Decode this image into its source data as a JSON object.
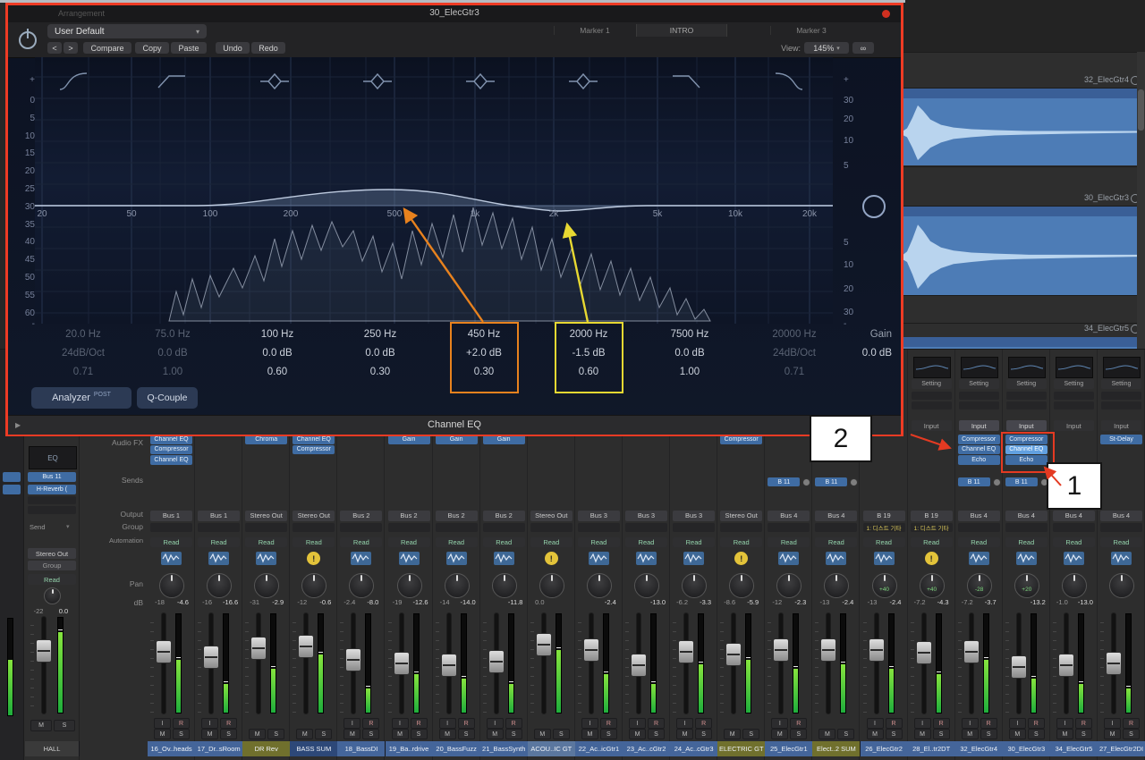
{
  "chrome": {
    "arrangement_label": "Arrangement"
  },
  "colors": {
    "annotation_red": "#ee3b24",
    "annotation_orange": "#e8821e",
    "annotation_yellow": "#e7d832",
    "plugin_open_blue": "#62a0e0",
    "region_blue": "#4d7cb6"
  },
  "eq_window": {
    "window_title": "30_ElecGtr3",
    "markers": [
      "Marker 1",
      "INTRO",
      "Marker 3"
    ],
    "preset_value": "User Default",
    "nav_prev": "<",
    "nav_next": ">",
    "buttons": {
      "compare": "Compare",
      "copy": "Copy",
      "paste": "Paste",
      "undo": "Undo",
      "redo": "Redo"
    },
    "view_label": "View:",
    "view_value": "145%",
    "link_icon": "∞",
    "scale_plus": "+",
    "scale_minus": "-",
    "freq_axis": [
      "20",
      "50",
      "100",
      "200",
      "500",
      "1k",
      "2k",
      "5k",
      "10k",
      "20k"
    ],
    "db_scale_left": [
      "0",
      "5",
      "10",
      "15",
      "20",
      "25",
      "30",
      "35",
      "40",
      "45",
      "50",
      "55",
      "60"
    ],
    "db_scale_right_top": [
      "30",
      "20",
      "10",
      "5"
    ],
    "db_scale_right_bottom": [
      "5",
      "10",
      "20",
      "30"
    ],
    "bands": [
      {
        "freq": "20.0 Hz",
        "gain": "24dB/Oct",
        "q": "0.71",
        "dim": true
      },
      {
        "freq": "75.0 Hz",
        "gain": "0.0 dB",
        "q": "1.00",
        "dim": true
      },
      {
        "freq": "100 Hz",
        "gain": "0.0 dB",
        "q": "0.60",
        "dim": false
      },
      {
        "freq": "250 Hz",
        "gain": "0.0 dB",
        "q": "0.30",
        "dim": false
      },
      {
        "freq": "450 Hz",
        "gain": "+2.0 dB",
        "q": "0.30",
        "dim": false
      },
      {
        "freq": "2000 Hz",
        "gain": "-1.5 dB",
        "q": "0.60",
        "dim": false
      },
      {
        "freq": "7500 Hz",
        "gain": "0.0 dB",
        "q": "1.00",
        "dim": false
      },
      {
        "freq": "20000 Hz",
        "gain": "24dB/Oct",
        "q": "0.71",
        "dim": true
      }
    ],
    "gain_label": "Gain",
    "gain_value": "0.0 dB",
    "analyzer_label": "Analyzer",
    "analyzer_mode": "POST",
    "q_couple_label": "Q-Couple",
    "footer_title": "Channel EQ"
  },
  "annotations": {
    "callout_1": "1",
    "callout_2": "2"
  },
  "arrange": {
    "tracks": [
      {
        "name": "32_ElecGtr4"
      },
      {
        "name": "30_ElecGtr3"
      },
      {
        "name": "34_ElecGtr5"
      }
    ]
  },
  "mixer": {
    "row_labels": [
      "Audio FX",
      "Sends",
      "Output",
      "Group",
      "Automation",
      "Pan",
      "dB"
    ],
    "common": {
      "setting": "Setting",
      "input": "Input",
      "read": "Read",
      "mute": "M",
      "solo": "S",
      "im": "I",
      "rec": "R"
    },
    "left_strip": {
      "eq_label": "EQ",
      "input": "Bus 11",
      "fx": "H-Reverb (",
      "send_label": "Send",
      "output": "Stereo Out",
      "group": "Group",
      "automation": "Read",
      "db_left": "-22",
      "db_right": "0.0",
      "mute": "M",
      "solo": "S",
      "name": "HALL"
    },
    "strips": [
      {
        "name": "16_Ov..heads",
        "fx": [
          "Channel EQ",
          "Compressor",
          "Channel EQ"
        ],
        "sends": [],
        "output": "Bus 1",
        "group": "",
        "pan": "",
        "db": [
          "-18",
          "-4.6"
        ],
        "icon": "wave",
        "ir": true,
        "top": false,
        "fader": 0.35,
        "meter": 0.55,
        "color": "blue"
      },
      {
        "name": "17_Dr..sRoom",
        "fx": [],
        "sends": [],
        "output": "Bus 1",
        "group": "",
        "pan": "",
        "db": [
          "-16",
          "-16.6"
        ],
        "icon": "wave",
        "ir": true,
        "top": false,
        "fader": 0.42,
        "meter": 0.3,
        "color": "blue"
      },
      {
        "name": "DR Rev",
        "fx": [
          "Chroma"
        ],
        "sends": [],
        "output": "Stereo Out",
        "group": "",
        "pan": "",
        "db": [
          "-31",
          "-2.9"
        ],
        "icon": "wave",
        "ir": false,
        "top": false,
        "fader": 0.3,
        "meter": 0.45,
        "color": "olive"
      },
      {
        "name": "BASS SUM",
        "fx": [
          "Channel EQ",
          "Compressor"
        ],
        "sends": [],
        "output": "Stereo Out",
        "group": "",
        "pan": "",
        "db": [
          "-12",
          "-0.6"
        ],
        "icon": "alert",
        "ir": false,
        "top": false,
        "fader": 0.28,
        "meter": 0.6,
        "color": "navy"
      },
      {
        "name": "18_BassDI",
        "fx": [],
        "sends": [],
        "output": "Bus 2",
        "group": "",
        "pan": "",
        "db": [
          "-2.4",
          "-8.0"
        ],
        "icon": "wave",
        "ir": true,
        "top": false,
        "fader": 0.45,
        "meter": 0.25,
        "color": "blue"
      },
      {
        "name": "19_Ba..rdrive",
        "fx": [
          "Gain"
        ],
        "sends": [],
        "output": "Bus 2",
        "group": "",
        "pan": "",
        "db": [
          "-19",
          "-12.6"
        ],
        "icon": "wave",
        "ir": true,
        "top": false,
        "fader": 0.5,
        "meter": 0.4,
        "color": "blue"
      },
      {
        "name": "20_BassFuzz",
        "fx": [
          "Gain"
        ],
        "sends": [],
        "output": "Bus 2",
        "group": "",
        "pan": "",
        "db": [
          "-14",
          "-14.0"
        ],
        "icon": "wave",
        "ir": true,
        "top": false,
        "fader": 0.52,
        "meter": 0.35,
        "color": "blue"
      },
      {
        "name": "21_BassSynth",
        "fx": [
          "Gain"
        ],
        "sends": [],
        "output": "Bus 2",
        "group": "",
        "pan": "",
        "db": [
          "",
          "-11.8"
        ],
        "icon": "wave",
        "ir": true,
        "top": false,
        "fader": 0.48,
        "meter": 0.3,
        "color": "blue"
      },
      {
        "name": "ACOU..IC GT",
        "fx": [],
        "sends": [],
        "output": "Stereo Out",
        "group": "",
        "pan": "",
        "db": [
          "0.0",
          ""
        ],
        "icon": "alert",
        "ir": false,
        "top": false,
        "fader": 0.25,
        "meter": 0.65,
        "color": "steel"
      },
      {
        "name": "22_Ac..icGtr1",
        "fx": [],
        "sends": [],
        "output": "Bus 3",
        "group": "",
        "pan": "",
        "db": [
          "",
          "-2.4"
        ],
        "icon": "wave",
        "ir": true,
        "top": false,
        "fader": 0.33,
        "meter": 0.4,
        "color": "blue"
      },
      {
        "name": "23_Ac..cGtr2",
        "fx": [],
        "sends": [],
        "output": "Bus 3",
        "group": "",
        "pan": "",
        "db": [
          "",
          "-13.0"
        ],
        "icon": "wave",
        "ir": true,
        "top": false,
        "fader": 0.52,
        "meter": 0.3,
        "color": "blue"
      },
      {
        "name": "24_Ac..cGtr3",
        "fx": [],
        "sends": [],
        "output": "Bus 3",
        "group": "",
        "pan": "",
        "db": [
          "-6.2",
          "-3.3"
        ],
        "icon": "wave",
        "ir": true,
        "top": false,
        "fader": 0.35,
        "meter": 0.5,
        "color": "blue"
      },
      {
        "name": "ELECTRIC GT",
        "fx": [
          "Compressor"
        ],
        "sends": [],
        "output": "Stereo Out",
        "group": "",
        "pan": "",
        "db": [
          "-8.6",
          "-5.9"
        ],
        "icon": "alert",
        "ir": false,
        "top": false,
        "fader": 0.38,
        "meter": 0.55,
        "color": "olive"
      },
      {
        "name": "25_ElecGtr1",
        "fx": [],
        "sends": [
          "B 11"
        ],
        "output": "Bus 4",
        "group": "",
        "pan": "",
        "db": [
          "-12",
          "-2.3"
        ],
        "icon": "wave",
        "ir": true,
        "top": false,
        "fader": 0.32,
        "meter": 0.45,
        "color": "blue"
      },
      {
        "name": "Elect..2 SUM",
        "fx": [],
        "sends": [
          "B 11"
        ],
        "output": "Bus 4",
        "group": "",
        "pan": "",
        "db": [
          "-13",
          "-2.4"
        ],
        "icon": "wave",
        "ir": false,
        "top": false,
        "fader": 0.33,
        "meter": 0.5,
        "color": "olive"
      },
      {
        "name": "26_ElecGtr2",
        "fx": [],
        "sends": [],
        "output": "B 19",
        "group": "1: 디스트 기타",
        "pan": "+40",
        "db": [
          "-13",
          "-2.4"
        ],
        "icon": "wave",
        "ir": true,
        "top": false,
        "fader": 0.33,
        "meter": 0.45,
        "color": "blue"
      },
      {
        "name": "28_El..tr2DT",
        "fx": [],
        "sends": [],
        "output": "B 19",
        "group": "1: 디스트 기타",
        "pan": "+40",
        "db": [
          "-7.2",
          "-4.3"
        ],
        "icon": "alert",
        "ir": true,
        "top": true,
        "fader": 0.36,
        "meter": 0.4,
        "color": "blue"
      },
      {
        "name": "32_ElecGtr4",
        "fx": [
          "Compressor",
          "Channel EQ",
          "Echo"
        ],
        "sends": [
          "B 11"
        ],
        "output": "Bus 4",
        "group": "",
        "pan": "-28",
        "db": [
          "-7.2",
          "-3.7"
        ],
        "icon": "wave",
        "ir": true,
        "top": true,
        "fader": 0.35,
        "meter": 0.55,
        "color": "blue"
      },
      {
        "name": "30_ElecGtr3",
        "fx": [
          "Compressor",
          "Channel EQ",
          "Echo"
        ],
        "fx_open": 1,
        "boxed": true,
        "sends": [
          "B 11"
        ],
        "output": "Bus 4",
        "group": "",
        "pan": "+20",
        "db": [
          "",
          "-13.2"
        ],
        "icon": "wave",
        "ir": true,
        "top": true,
        "fader": 0.55,
        "meter": 0.35,
        "color": "blue"
      },
      {
        "name": "34_ElecGtr5",
        "fx": [],
        "sends": [],
        "output": "Bus 4",
        "group": "",
        "pan": "",
        "db": [
          "-1.0",
          "-13.0"
        ],
        "icon": "wave",
        "ir": true,
        "top": true,
        "fader": 0.52,
        "meter": 0.3,
        "color": "blue"
      },
      {
        "name": "27_ElecGtr2DI",
        "fx": [
          "St-Delay"
        ],
        "sends": [],
        "output": "Bus 4",
        "group": "",
        "pan": "",
        "db": [
          "",
          ""
        ],
        "icon": "wave",
        "ir": true,
        "top": true,
        "fader": 0.5,
        "meter": 0.25,
        "color": "blue"
      }
    ]
  }
}
